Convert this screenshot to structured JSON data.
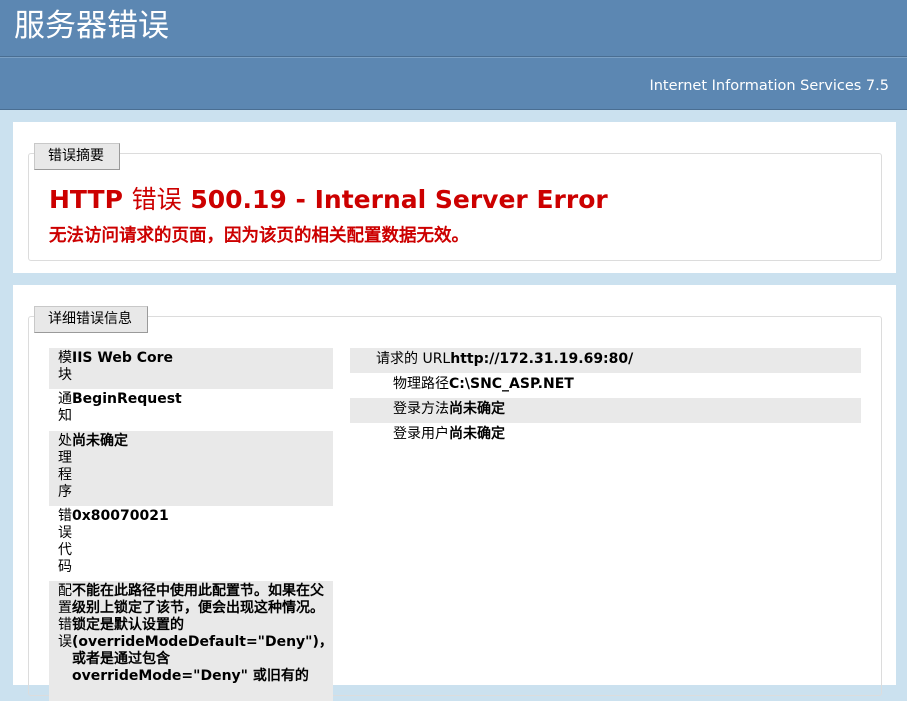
{
  "page_title": "服务器错误",
  "server_name": "Internet Information Services 7.5",
  "summary": {
    "legend": "错误摘要",
    "title_prefix": "HTTP ",
    "title_cjk": "错误",
    "title_suffix": " 500.19 - Internal Server Error",
    "description": "无法访问请求的页面，因为该页的相关配置数据无效。"
  },
  "detail": {
    "legend": "详细错误信息",
    "left": [
      {
        "label": "模块",
        "value": "IIS Web Core"
      },
      {
        "label": "通知",
        "value": "BeginRequest"
      },
      {
        "label": "处理程序",
        "value": "尚未确定"
      },
      {
        "label": "错误代码",
        "value": "0x80070021"
      },
      {
        "label": "配置错误",
        "value": "不能在此路径中使用此配置节。如果在父级别上锁定了该节，便会出现这种情况。锁定是默认设置的(overrideModeDefault=\"Deny\")，或者是通过包含 overrideMode=\"Deny\" 或旧有的"
      }
    ],
    "right": [
      {
        "label": "请求的 URL",
        "value": "http://172.31.19.69:80/"
      },
      {
        "label": "物理路径",
        "value": "C:\\SNC_ASP.NET"
      },
      {
        "label": "登录方法",
        "value": "尚未确定"
      },
      {
        "label": "登录用户",
        "value": "尚未确定"
      }
    ]
  }
}
